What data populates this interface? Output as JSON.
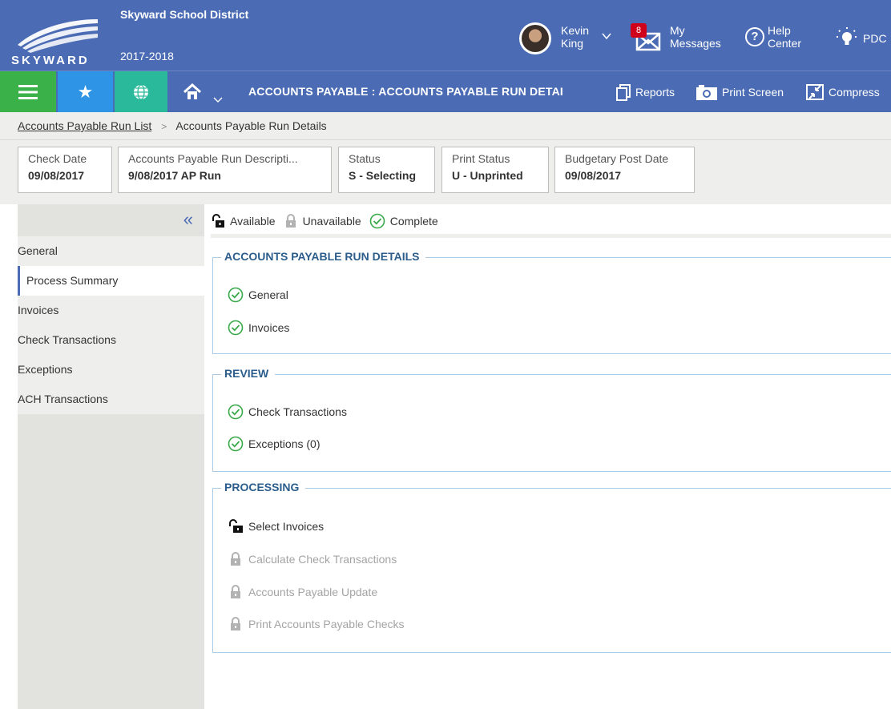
{
  "header": {
    "district": "Skyward School District",
    "year": "2017-2018",
    "logo_text": "SKYWARD",
    "user": {
      "first": "Kevin",
      "last": "King"
    },
    "messages": {
      "badge": "8",
      "line1": "My",
      "line2": "Messages"
    },
    "help": {
      "line1": "Help",
      "line2": "Center"
    },
    "pdc_label": "PDC"
  },
  "toolbar": {
    "title": "ACCOUNTS PAYABLE : ACCOUNTS PAYABLE RUN DETAI",
    "reports": "Reports",
    "print_screen": "Print Screen",
    "compress": "Compress"
  },
  "breadcrumb": {
    "parent": "Accounts Payable Run List",
    "current": "Accounts Payable Run Details"
  },
  "summary": [
    {
      "label": "Check Date",
      "value": "09/08/2017"
    },
    {
      "label": "Accounts Payable Run Descripti...",
      "value": "9/08/2017 AP Run"
    },
    {
      "label": "Status",
      "value": "S - Selecting"
    },
    {
      "label": "Print Status",
      "value": "U - Unprinted"
    },
    {
      "label": "Budgetary Post Date",
      "value": "09/08/2017"
    }
  ],
  "sidebar": {
    "items": [
      {
        "label": "General"
      },
      {
        "label": "Process Summary",
        "active": true
      },
      {
        "label": "Invoices"
      },
      {
        "label": "Check Transactions"
      },
      {
        "label": "Exceptions"
      },
      {
        "label": "ACH Transactions"
      }
    ]
  },
  "legend": {
    "available": "Available",
    "unavailable": "Unavailable",
    "complete": "Complete"
  },
  "sections": {
    "details": {
      "title": "ACCOUNTS PAYABLE RUN DETAILS",
      "steps": [
        {
          "label": "General",
          "state": "complete"
        },
        {
          "label": "Invoices",
          "state": "complete"
        }
      ]
    },
    "review": {
      "title": "REVIEW",
      "steps": [
        {
          "label": "Check Transactions",
          "state": "complete"
        },
        {
          "label": "Exceptions (0)",
          "state": "complete"
        }
      ]
    },
    "processing": {
      "title": "PROCESSING",
      "steps": [
        {
          "label": "Select Invoices",
          "state": "available"
        },
        {
          "label": "Calculate Check Transactions",
          "state": "unavailable"
        },
        {
          "label": "Accounts Payable Update",
          "state": "unavailable"
        },
        {
          "label": "Print Accounts Payable Checks",
          "state": "unavailable"
        }
      ]
    }
  },
  "colors": {
    "header_bg": "#4b6cb4",
    "menu_green": "#3bb14a",
    "star_blue": "#2e95e6",
    "globe_teal": "#2ab99b",
    "complete_green": "#3aa94a",
    "section_title": "#2b5d8c"
  }
}
